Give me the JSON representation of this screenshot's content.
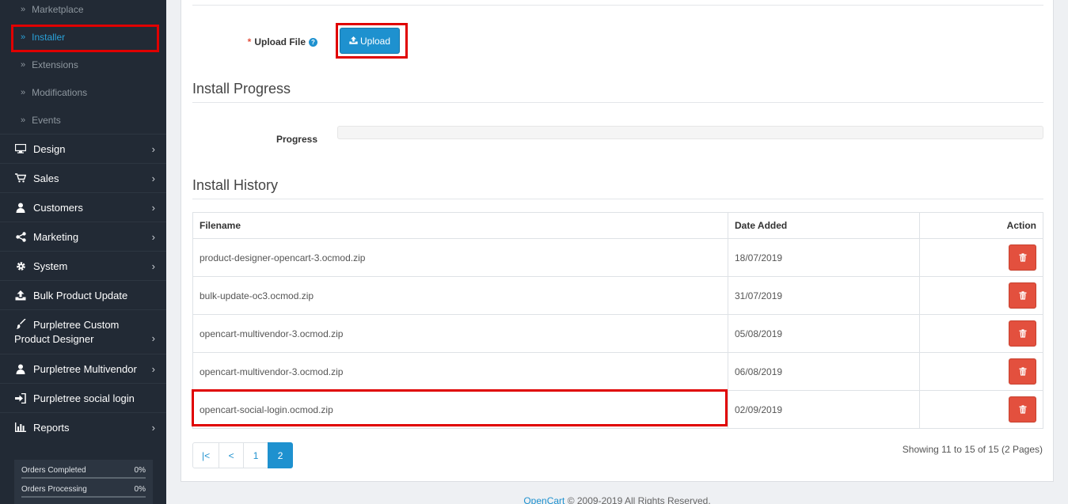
{
  "sidebar": {
    "sub_items": [
      {
        "label": "Marketplace"
      },
      {
        "label": "Installer"
      },
      {
        "label": "Extensions"
      },
      {
        "label": "Modifications"
      },
      {
        "label": "Events"
      }
    ],
    "menu": [
      {
        "label": "Design",
        "icon": "monitor-icon"
      },
      {
        "label": "Sales",
        "icon": "cart-icon"
      },
      {
        "label": "Customers",
        "icon": "user-icon"
      },
      {
        "label": "Marketing",
        "icon": "share-icon"
      },
      {
        "label": "System",
        "icon": "gear-icon"
      },
      {
        "label": "Bulk Product Update",
        "icon": "upload-icon"
      },
      {
        "label": "Purpletree Custom Product Designer",
        "icon": "brush-icon"
      },
      {
        "label": "Purpletree Multivendor",
        "icon": "user-icon"
      },
      {
        "label": "Purpletree social login",
        "icon": "sign-in-icon"
      },
      {
        "label": "Reports",
        "icon": "bar-chart-icon"
      }
    ],
    "stats": [
      {
        "label": "Orders Completed",
        "value": "0%"
      },
      {
        "label": "Orders Processing",
        "value": "0%"
      }
    ]
  },
  "upload": {
    "label": "Upload File",
    "button_label": "Upload"
  },
  "install_progress": {
    "title": "Install Progress",
    "progress_label": "Progress",
    "progress_value": 0
  },
  "install_history": {
    "title": "Install History",
    "columns": {
      "filename": "Filename",
      "date_added": "Date Added",
      "action": "Action"
    },
    "rows": [
      {
        "filename": "product-designer-opencart-3.ocmod.zip",
        "date": "18/07/2019"
      },
      {
        "filename": "bulk-update-oc3.ocmod.zip",
        "date": "31/07/2019"
      },
      {
        "filename": "opencart-multivendor-3.ocmod.zip",
        "date": "05/08/2019"
      },
      {
        "filename": "opencart-multivendor-3.ocmod.zip",
        "date": "06/08/2019"
      },
      {
        "filename": "opencart-social-login.ocmod.zip",
        "date": "02/09/2019"
      }
    ]
  },
  "pagination": {
    "first": "|<",
    "prev": "<",
    "pages": [
      "1",
      "2"
    ],
    "active": "2",
    "showing": "Showing 11 to 15 of 15 (2 Pages)"
  },
  "footer": {
    "brand": "OpenCart",
    "text": " © 2009-2019 All Rights Reserved."
  },
  "colors": {
    "sidebar_bg": "#222a35",
    "primary": "#1e91cf",
    "danger": "#e3503e",
    "highlight": "#e00000"
  }
}
